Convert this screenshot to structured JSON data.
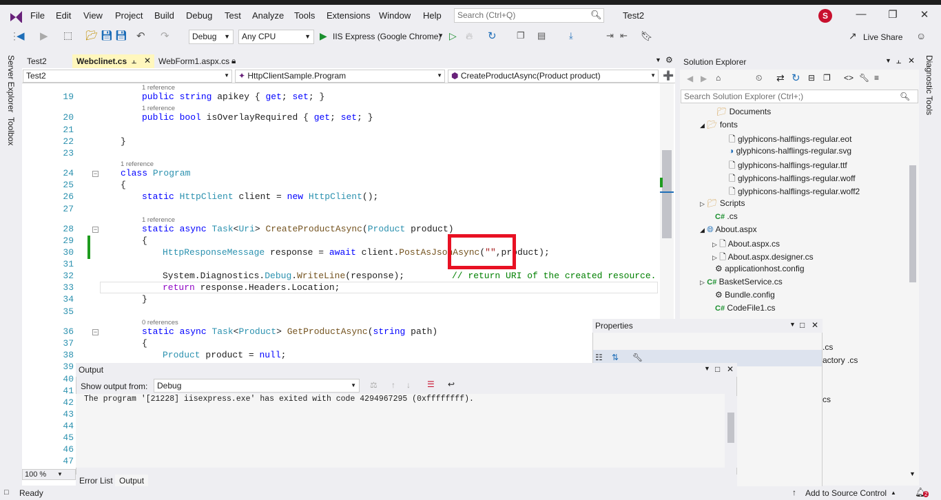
{
  "menu": [
    "File",
    "Edit",
    "View",
    "Project",
    "Build",
    "Debug",
    "Test",
    "Analyze",
    "Tools",
    "Extensions",
    "Window",
    "Help"
  ],
  "search": {
    "placeholder": "Search (Ctrl+Q)"
  },
  "window_title": "Test2",
  "avatar_letter": "S",
  "toolbar": {
    "config": "Debug",
    "platform": "Any CPU",
    "run_target": "IIS Express (Google Chrome)",
    "live_share": "Live Share"
  },
  "left_tools": [
    "Server Explorer",
    "Toolbox"
  ],
  "right_tools": [
    "Diagnostic Tools"
  ],
  "tabs": [
    {
      "label": "Test2"
    },
    {
      "label": "Webclinet.cs"
    },
    {
      "label": "WebForm1.aspx.cs"
    }
  ],
  "nav": {
    "project": "Test2",
    "class": "HttpClientSample.Program",
    "member": "CreateProductAsync(Product product)"
  },
  "code": {
    "line_numbers": [
      "19",
      "20",
      "21",
      "22",
      "23",
      "24",
      "25",
      "26",
      "27",
      "28",
      "29",
      "30",
      "31",
      "32",
      "33",
      "34",
      "35",
      "36",
      "37",
      "38",
      "39",
      "40",
      "41",
      "42",
      "43",
      "44",
      "45",
      "46",
      "47"
    ],
    "refs": [
      "1 reference",
      "1 reference",
      "1 reference",
      "1 reference",
      "0 references"
    ],
    "l19_a": "public",
    "l19_b": "string",
    "l19_c": "apikey { ",
    "l19_d": "get",
    "l19_e": "; ",
    "l19_f": "set",
    "l19_g": "; }",
    "l20_a": "public",
    "l20_b": "bool",
    "l20_c": "isOverlayRequired { ",
    "l20_d": "get",
    "l20_e": "; ",
    "l20_f": "set",
    "l20_g": "; }",
    "brace_close": "}",
    "brace_open": "{",
    "l24_a": "class",
    "l24_b": "Program",
    "l26_a": "static",
    "l26_b": "HttpClient",
    "l26_c": "client = ",
    "l26_d": "new",
    "l26_e": "HttpClient",
    "l26_f": "();",
    "l28_a": "static",
    "l28_b": "async",
    "l28_c": "Task",
    "l28_d": "<",
    "l28_e": "Uri",
    "l28_f": "> ",
    "l28_g": "CreateProductAsync",
    "l28_h": "(",
    "l28_i": "Product",
    "l28_j": " product)",
    "l30_a": "HttpResponseMessage",
    "l30_b": " response = ",
    "l30_c": "await",
    "l30_d": " client.",
    "l30_e": "PostAsJsonAsync",
    "l30_f": "(",
    "l30_g": "\"\"",
    "l30_h": ",product);",
    "l32_a": "System.Diagnostics.",
    "l32_b": "Debug",
    "l32_c": ".",
    "l32_d": "WriteLine",
    "l32_e": "(response);",
    "l32_f": "// return URI of the created resource.",
    "l33_a": "return",
    "l33_b": " response.Headers.Location;",
    "l36_a": "static",
    "l36_b": "async",
    "l36_c": "Task",
    "l36_d": "<",
    "l36_e": "Product",
    "l36_f": "> ",
    "l36_g": "GetProductAsync",
    "l36_h": "(",
    "l36_i": "string",
    "l36_j": " path)",
    "l38_a": "Product",
    "l38_b": " product = ",
    "l38_c": "null",
    "l38_d": ";"
  },
  "zoom": "100 %",
  "solution_explorer": {
    "title": "Solution Explorer",
    "search_placeholder": "Search Solution Explorer (Ctrl+;)",
    "items": [
      "Documents",
      "fonts",
      "glyphicons-halflings-regular.eot",
      "glyphicons-halflings-regular.svg",
      "glyphicons-halflings-regular.ttf",
      "glyphicons-halflings-regular.woff",
      "glyphicons-halflings-regular.woff2",
      "Scripts",
      ".cs",
      "About.aspx",
      "About.aspx.cs",
      "About.aspx.designer.cs",
      "applicationhost.config",
      "BasketService.cs",
      "Bundle.config",
      "CodeFile1.cs"
    ],
    "partial": [
      ".cs",
      "actory .cs",
      "cs"
    ]
  },
  "properties": {
    "title": "Properties"
  },
  "output": {
    "title": "Output",
    "show_from_label": "Show output from:",
    "source": "Debug",
    "text": "The program '[21228] iisexpress.exe' has exited with code 4294967295 (0xffffffff)."
  },
  "bottom_tabs": [
    "Error List",
    "Output"
  ],
  "status": {
    "ready": "Ready",
    "source_control": "Add to Source Control",
    "notifications": "2"
  },
  "colors": {
    "accent": "#68217a",
    "highlight": "#e81123",
    "active_tab": "#fff7bd"
  }
}
